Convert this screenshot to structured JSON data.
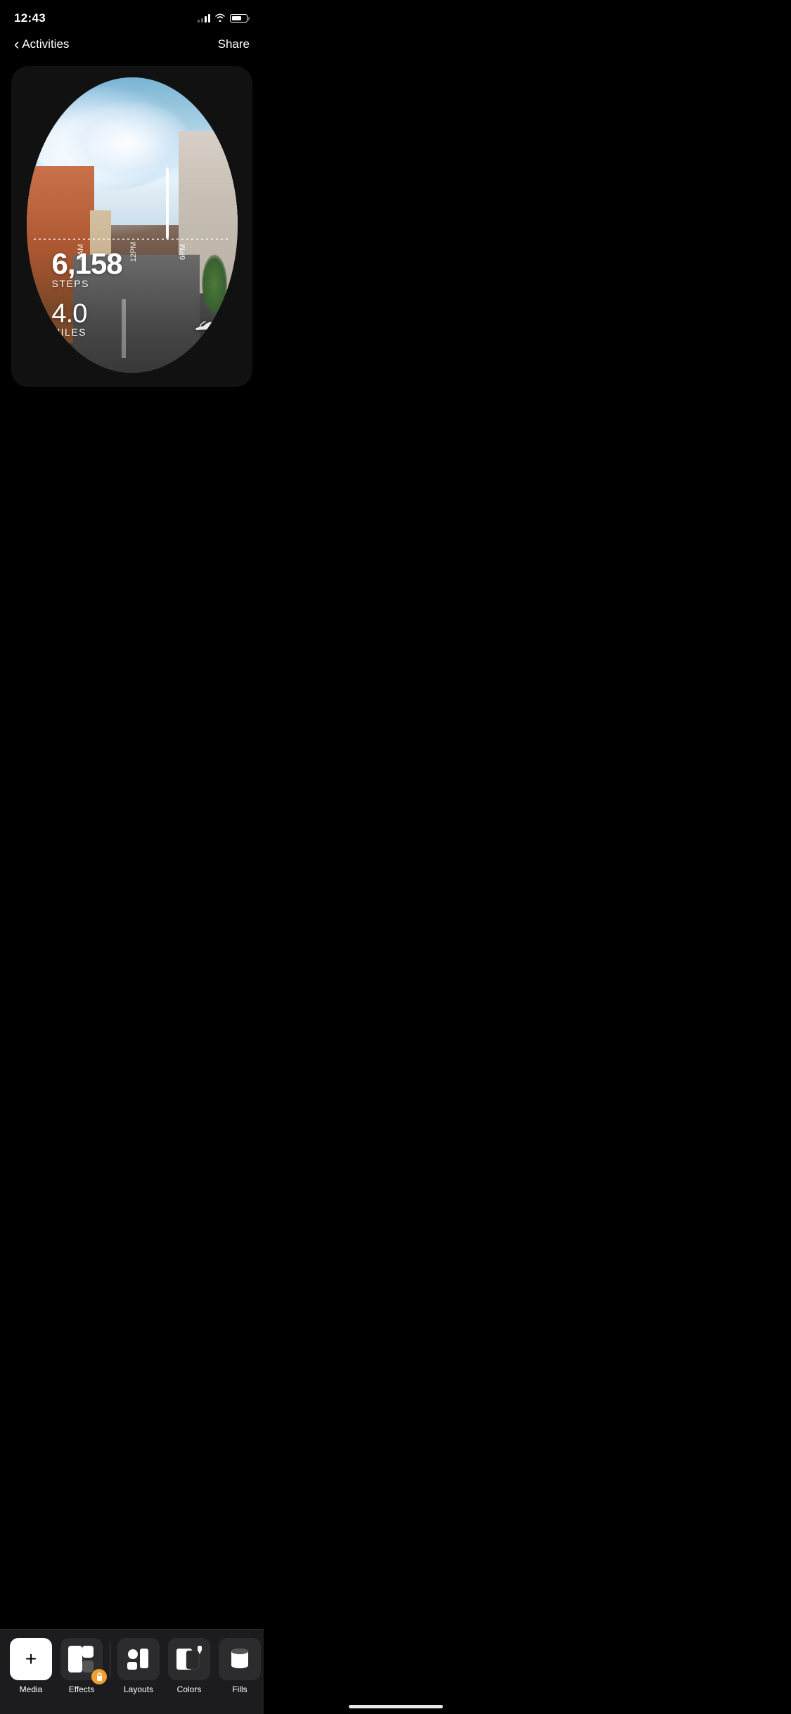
{
  "statusBar": {
    "time": "12:43"
  },
  "navBar": {
    "backLabel": "Activities",
    "shareLabel": "Share"
  },
  "activity": {
    "steps": "6,158",
    "stepsLabel": "STEPS",
    "miles": "4.0",
    "milesLabel": "MILES"
  },
  "chart": {
    "timeLabels": [
      "6AM",
      "12PM",
      "6PM"
    ]
  },
  "toolbar": {
    "items": [
      {
        "id": "media",
        "label": "Media",
        "icon": "plus"
      },
      {
        "id": "effects",
        "label": "Effects",
        "icon": "layers",
        "locked": true
      },
      {
        "id": "layouts",
        "label": "Layouts",
        "icon": "layouts"
      },
      {
        "id": "colors",
        "label": "Colors",
        "icon": "colors"
      },
      {
        "id": "fills",
        "label": "Fills",
        "icon": "fills"
      }
    ]
  }
}
